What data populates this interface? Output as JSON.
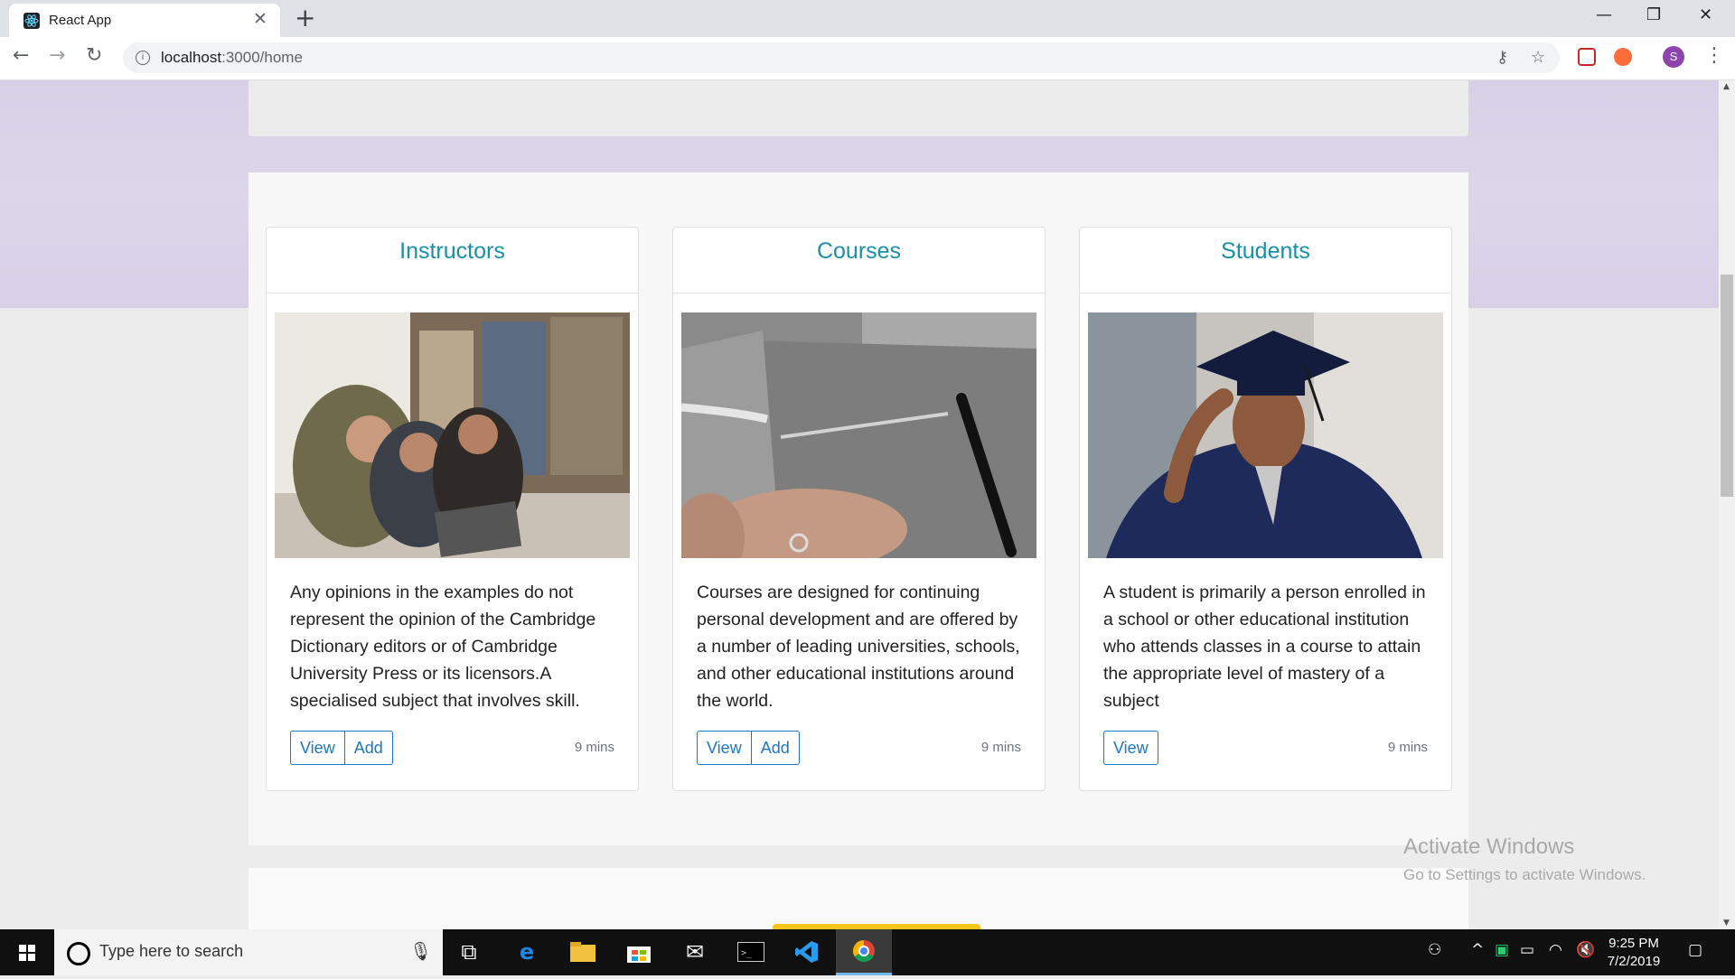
{
  "browser": {
    "tab_title": "React App",
    "tab_close": "✕",
    "new_tab": "+",
    "url_host": "localhost",
    "url_path": ":3000/home",
    "window_minimize": "—",
    "window_restore": "❐",
    "window_close": "✕",
    "avatar_initial": "S"
  },
  "cards": [
    {
      "title": "Instructors",
      "text": "Any opinions in the examples do not represent the opinion of the Cambridge Dictionary editors or of Cambridge University Press or its licensors.A specialised subject that involves skill.",
      "buttons": [
        "View",
        "Add"
      ],
      "time": "9 mins"
    },
    {
      "title": "Courses",
      "text": "Courses are designed for continuing personal development and are offered by a number of leading universities, schools, and other educational institutions around the world.",
      "buttons": [
        "View",
        "Add"
      ],
      "time": "9 mins"
    },
    {
      "title": "Students",
      "text": "A student is primarily a person enrolled in a school or other educational institution who attends classes in a course to attain the appropriate level of mastery of a subject",
      "buttons": [
        "View"
      ],
      "time": "9 mins"
    }
  ],
  "watermark": {
    "line1": "Activate Windows",
    "line2": "Go to Settings to activate Windows."
  },
  "taskbar": {
    "search_placeholder": "Type here to search",
    "time": "9:25 PM",
    "date": "7/2/2019"
  },
  "colors": {
    "card_title": "#1a8fa8",
    "button": "#1c77c3",
    "hero_background": "#d8d0e6"
  }
}
